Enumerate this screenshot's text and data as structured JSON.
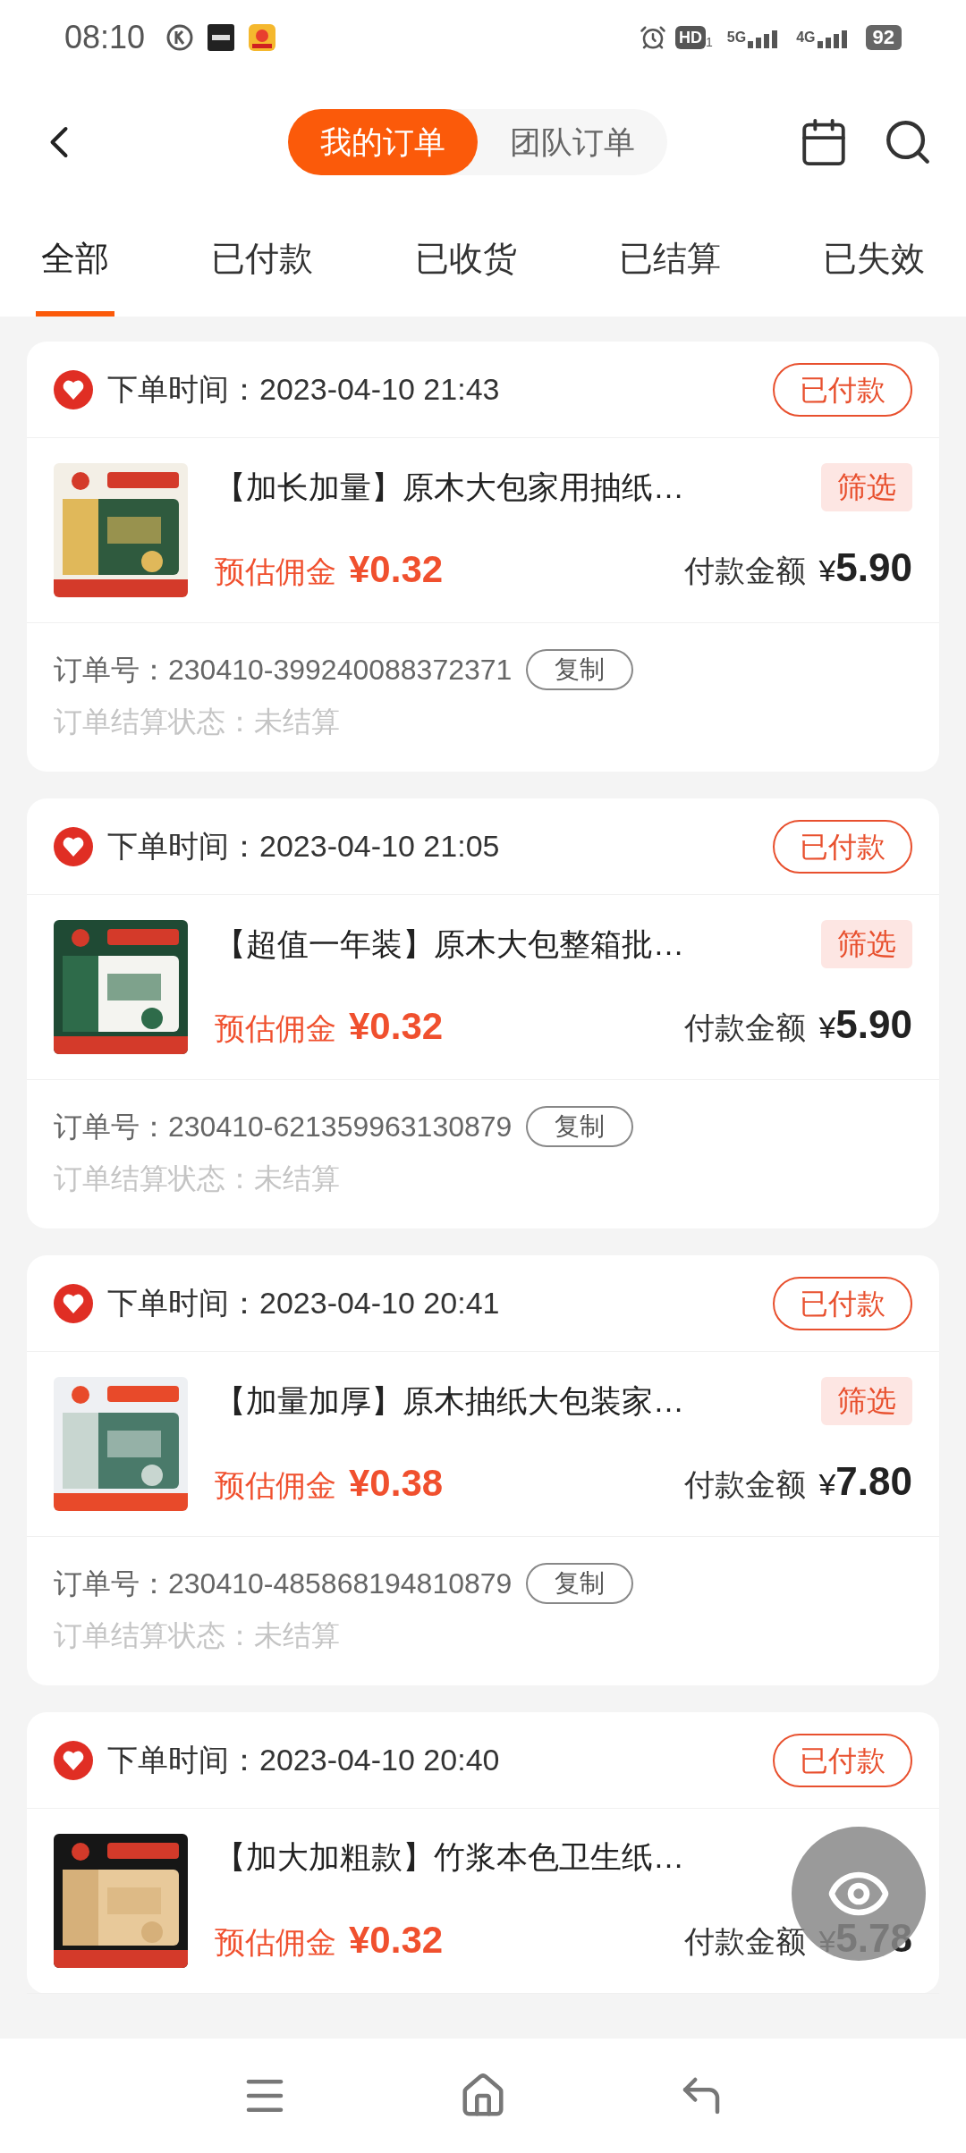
{
  "status_bar": {
    "time": "08:10",
    "hd": "HD",
    "hd_sub": "1",
    "net_1": "5G",
    "net_2": "4G",
    "battery": "92"
  },
  "header": {
    "segments": [
      {
        "label": "我的订单",
        "selected": true
      },
      {
        "label": "团队订单",
        "selected": false
      }
    ]
  },
  "tabs": [
    {
      "label": "全部",
      "selected": true
    },
    {
      "label": "已付款",
      "selected": false
    },
    {
      "label": "已收货",
      "selected": false
    },
    {
      "label": "已结算",
      "selected": false
    },
    {
      "label": "已失效",
      "selected": false
    }
  ],
  "orders": [
    {
      "time_label": "下单时间：",
      "time": "2023-04-10 21:43",
      "status": "已付款",
      "title": "【加长加量】原木大包家用抽纸…",
      "filter": "筛选",
      "commission_label": "预估佣金",
      "commission": "¥0.32",
      "paid_label": "付款金额",
      "paid_currency": "¥",
      "paid": "5.90",
      "order_no_label": "订单号：",
      "order_no": "230410-399240088372371",
      "copy": "复制",
      "settle_label": "订单结算状态：",
      "settle": "未结算"
    },
    {
      "time_label": "下单时间：",
      "time": "2023-04-10 21:05",
      "status": "已付款",
      "title": "【超值一年装】原木大包整箱批…",
      "filter": "筛选",
      "commission_label": "预估佣金",
      "commission": "¥0.32",
      "paid_label": "付款金额",
      "paid_currency": "¥",
      "paid": "5.90",
      "order_no_label": "订单号：",
      "order_no": "230410-621359963130879",
      "copy": "复制",
      "settle_label": "订单结算状态：",
      "settle": "未结算"
    },
    {
      "time_label": "下单时间：",
      "time": "2023-04-10 20:41",
      "status": "已付款",
      "title": "【加量加厚】原木抽纸大包装家…",
      "filter": "筛选",
      "commission_label": "预估佣金",
      "commission": "¥0.38",
      "paid_label": "付款金额",
      "paid_currency": "¥",
      "paid": "7.80",
      "order_no_label": "订单号：",
      "order_no": "230410-485868194810879",
      "copy": "复制",
      "settle_label": "订单结算状态：",
      "settle": "未结算"
    },
    {
      "time_label": "下单时间：",
      "time": "2023-04-10 20:40",
      "status": "已付款",
      "title": "【加大加粗款】竹浆本色卫生纸…",
      "commission_label": "预估佣金",
      "commission": "¥0.32",
      "paid_label": "付款金额",
      "paid_currency": "¥",
      "paid": "5.78"
    }
  ]
}
